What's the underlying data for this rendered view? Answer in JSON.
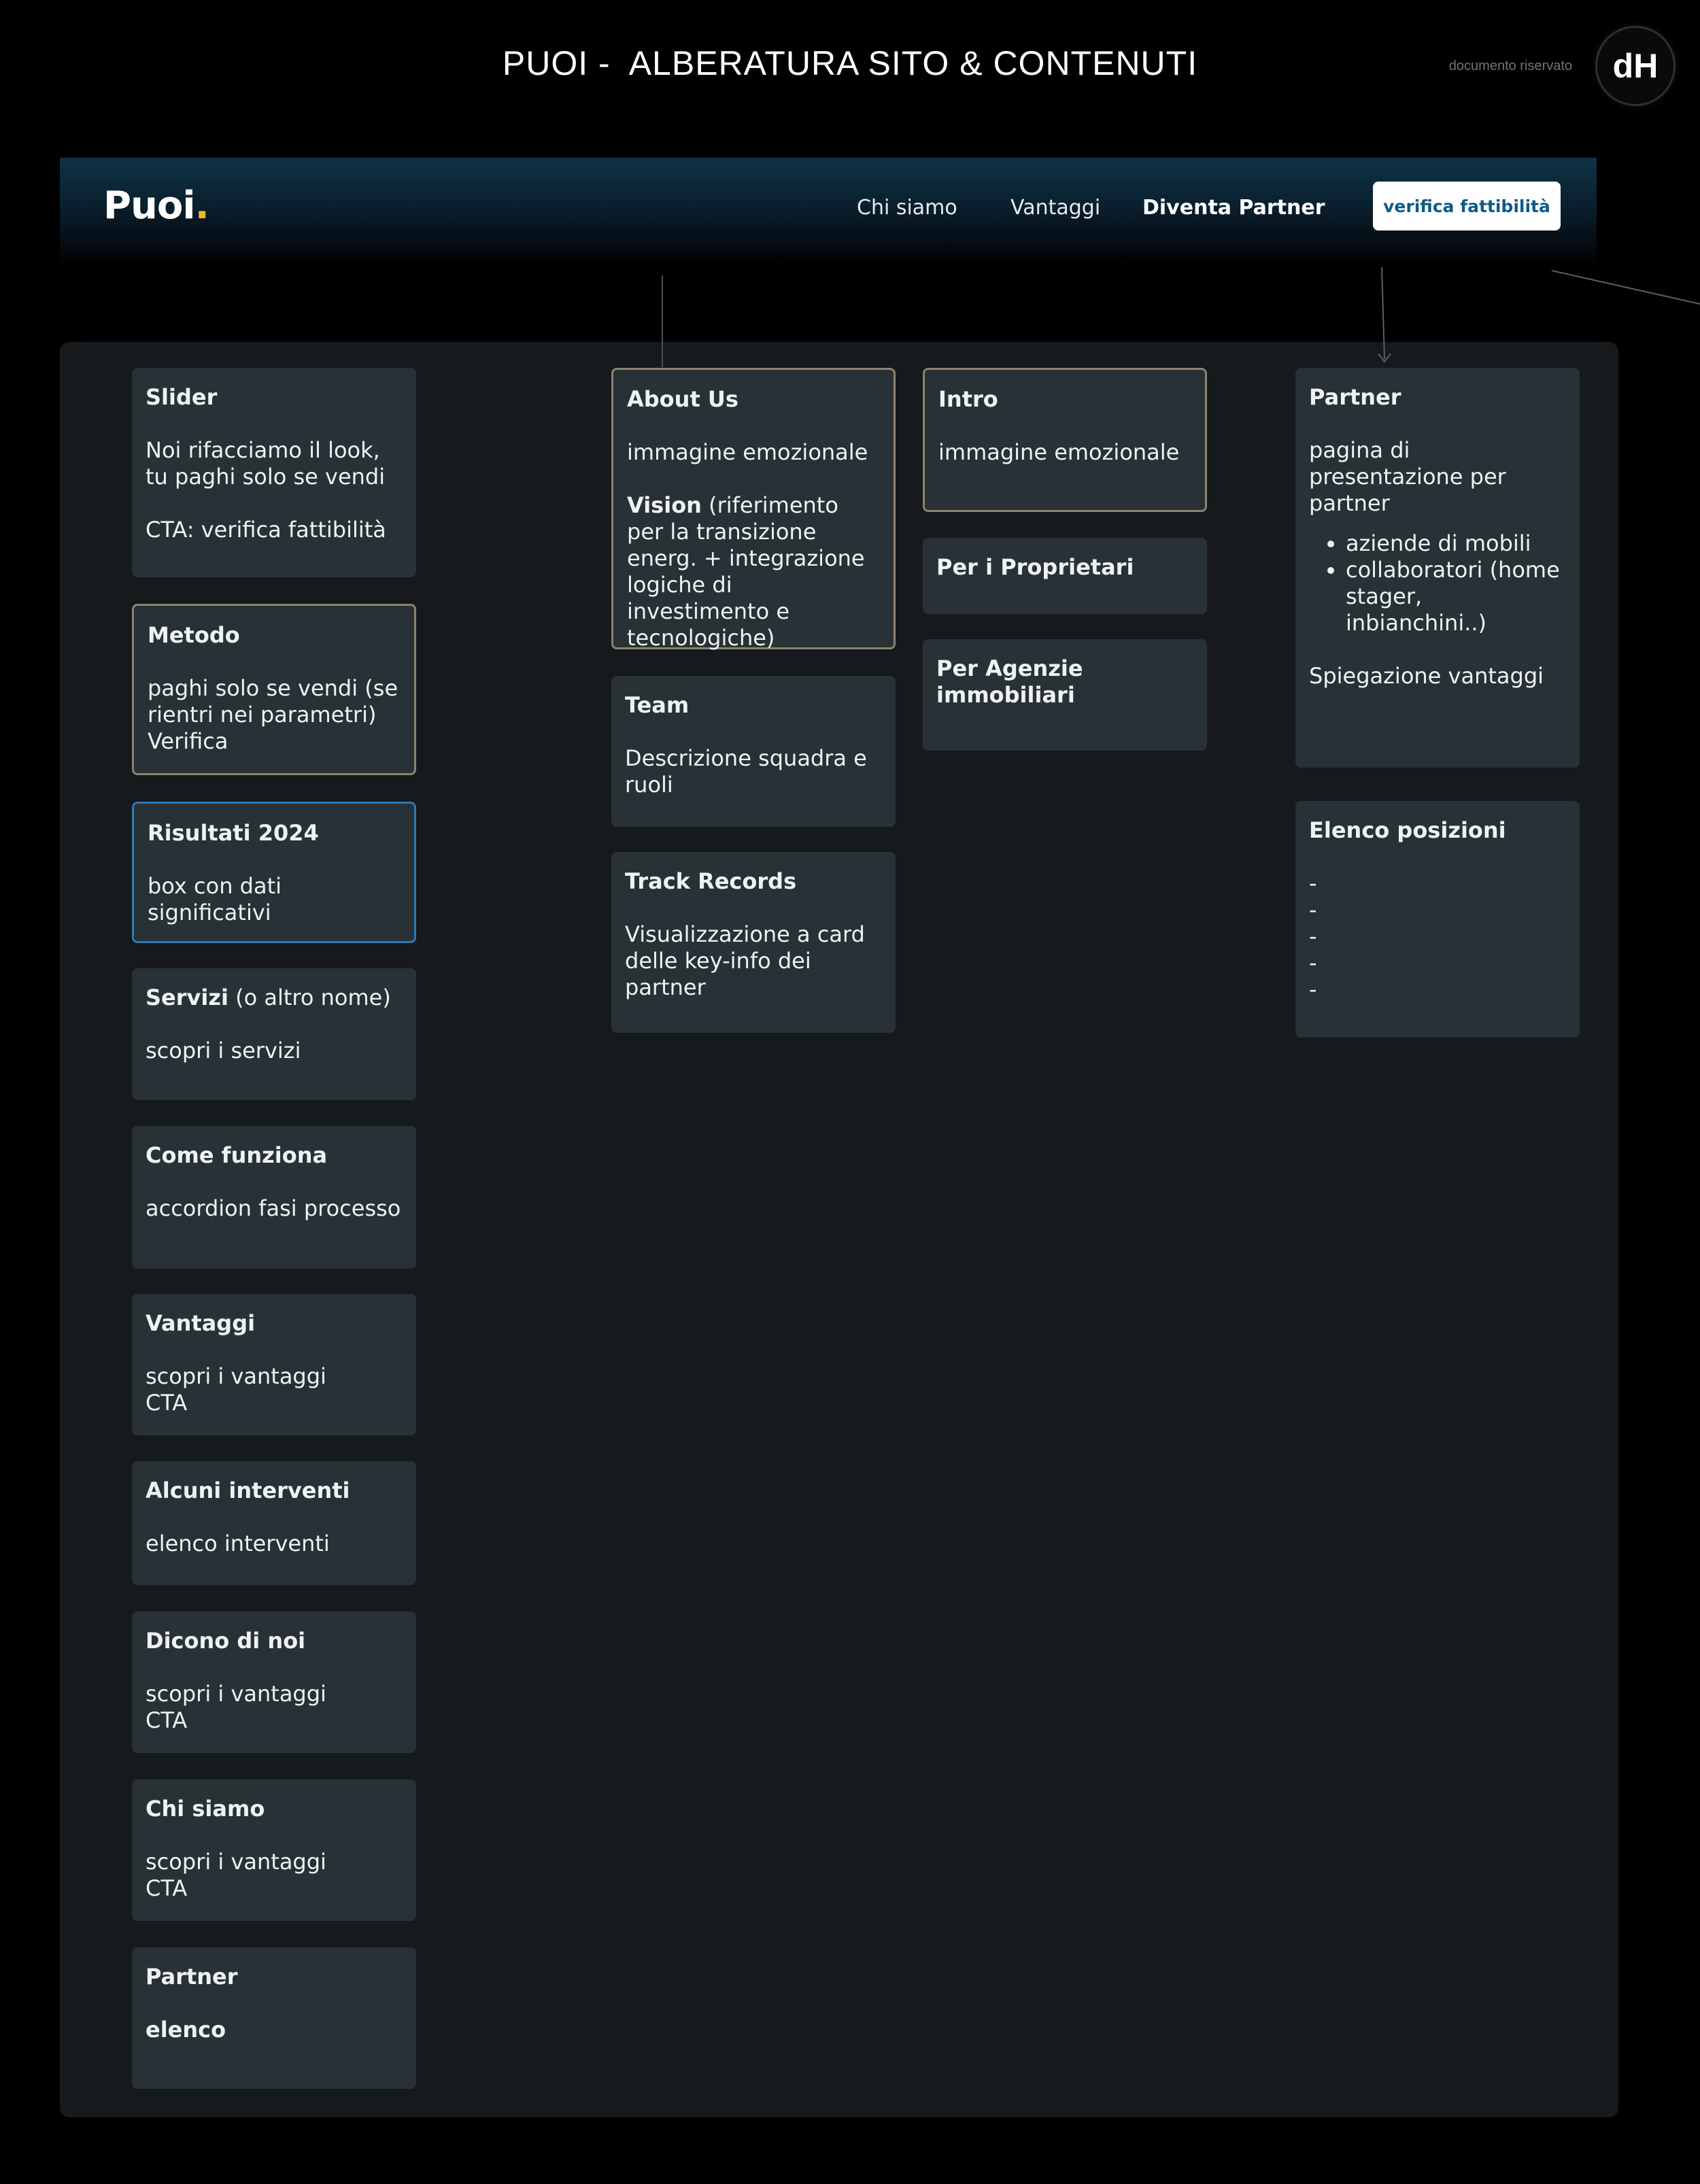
{
  "document": {
    "title": "PUOI -  ALBERATURA SITO & CONTENUTI",
    "reserved_label": "documento riservato",
    "badge_text": "dH"
  },
  "header": {
    "brand": "Puoi",
    "brand_dot": ".",
    "nav": [
      "Chi siamo",
      "Vantaggi",
      "Diventa Partner"
    ],
    "cta_label": "verifica fattibilità"
  },
  "colors": {
    "background": "#000000",
    "panel": "#161a1d",
    "card": "#283135",
    "card_border_highlight": "#8c8270",
    "card_border_selected": "#2c79b6",
    "brand_dot": "#f2b71c",
    "cta_text": "#0f5a86"
  },
  "home_column": [
    {
      "title": "Slider",
      "body": "Noi rifacciamo il look,\ntu paghi solo se vendi\n\nCTA: verifica fattibilità"
    },
    {
      "title": "Metodo",
      "body": "paghi solo se vendi (se rientri nei parametri)\nVerifica"
    },
    {
      "title": "Risultati 2024",
      "body": "box con dati significativi"
    },
    {
      "title": "Servizi",
      "title_suffix": " (o altro nome)",
      "body": "scopri i servizi"
    },
    {
      "title": "Come funziona",
      "body": "accordion fasi processo"
    },
    {
      "title": "Vantaggi",
      "body": "scopri i vantaggi\nCTA"
    },
    {
      "title": "Alcuni interventi",
      "body": "elenco interventi"
    },
    {
      "title": "Dicono di noi",
      "body": "scopri i vantaggi\n CTA"
    },
    {
      "title": "Chi siamo",
      "body": "scopri i vantaggi\n CTA"
    },
    {
      "title": "Partner",
      "body": "elenco"
    }
  ],
  "chi_siamo_column": [
    {
      "title": "About Us",
      "body": "immagine emozionale",
      "bold_word": "Vision",
      "body_after": " (riferimento per la transizione energ. + integrazione logiche di investimento e tecnologiche)"
    },
    {
      "title": "Team",
      "body": "Descrizione squadra e ruoli"
    },
    {
      "title": "Track Records",
      "body": "Visualizzazione a card delle key-info dei partner"
    }
  ],
  "vantaggi_column": [
    {
      "title": "Intro",
      "body": "immagine emozionale"
    },
    {
      "title": "Per i Proprietari"
    },
    {
      "title": "Per Agenzie immobiliari"
    }
  ],
  "partner_column": [
    {
      "title": "Partner",
      "body": "pagina di presentazione per partner",
      "bullets": [
        "aziende di mobili",
        "collaboratori (home stager, inbianchini..)"
      ],
      "footer": "Spiegazione vantaggi"
    },
    {
      "title": "Elenco posizioni",
      "body": "-\n-\n-\n-\n-"
    }
  ]
}
